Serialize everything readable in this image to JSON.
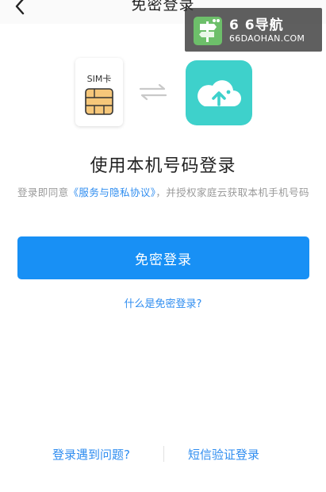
{
  "header": {
    "title": "免密登录",
    "back_icon": "chevron-left-icon"
  },
  "watermark": {
    "title": "6 6导航",
    "subtitle": "66DAOHAN.COM"
  },
  "icons": {
    "sim_label": "SIM卡",
    "sim_icon": "sim-card-icon",
    "swap_icon": "swap-arrows-icon",
    "app_icon": "cloud-icon",
    "app_color": "#3ed1cb"
  },
  "main": {
    "heading": "使用本机号码登录",
    "agreement_prefix": "登录即同意",
    "agreement_link": "《服务与隐私协议》",
    "agreement_suffix": "，并授权家庭云获取本机手机号码",
    "login_button": "免密登录",
    "what_is_link": "什么是免密登录?"
  },
  "footer": {
    "problem_link": "登录遇到问题?",
    "sms_link": "短信验证登录"
  },
  "colors": {
    "primary": "#1890f5",
    "link": "#2f8df0"
  }
}
